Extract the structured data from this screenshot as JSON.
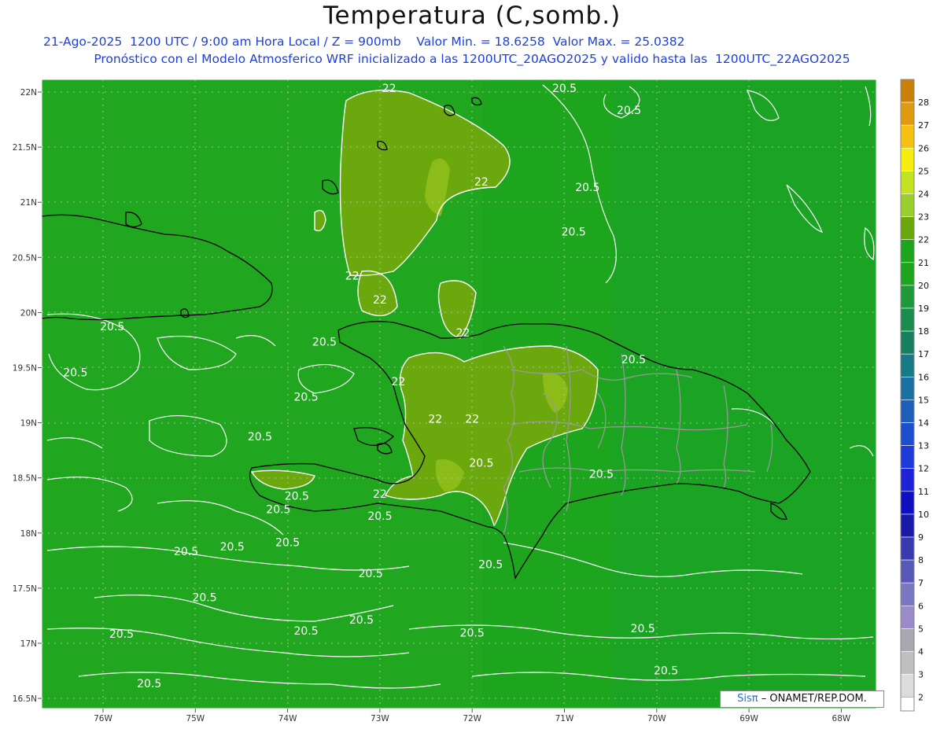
{
  "header": {
    "title": "Temperatura (C,somb.)",
    "subtitle_line1": "21-Ago-2025  1200 UTC / 9:00 am Hora Local / Z = 900mb    Valor Min. = 18.6258  Valor Max. = 25.0382",
    "subtitle_line2": "Pronóstico con el Modelo Atmosferico WRF inicializado a las 1200UTC_20AGO2025 y valido hasta las  1200UTC_22AGO2025"
  },
  "colors": {
    "title": "#111111",
    "subtitle": "#1f3fd9",
    "base_field": "#1ea51e",
    "warm_field": "#6aa80e",
    "warm_core": "#8cbc18",
    "contour": "#ffffff",
    "coast": "#000000",
    "provinces": "#9a9a9a"
  },
  "map": {
    "lat_labels": [
      "22N",
      "21.5N",
      "21N",
      "20.5N",
      "20N",
      "19.5N",
      "19N",
      "18.5N",
      "18N",
      "17.5N",
      "17N",
      "16.5N"
    ],
    "lon_labels": [
      "76W",
      "75W",
      "74W",
      "73W",
      "72W",
      "71W",
      "70W",
      "69W",
      "68W"
    ],
    "contour_labels": [
      {
        "text": "22",
        "lon": -72.9,
        "lat": 22.0
      },
      {
        "text": "22",
        "lon": -71.9,
        "lat": 21.15
      },
      {
        "text": "22",
        "lon": -73.3,
        "lat": 20.3
      },
      {
        "text": "22",
        "lon": -73.0,
        "lat": 20.08
      },
      {
        "text": "22",
        "lon": -72.1,
        "lat": 19.78
      },
      {
        "text": "22",
        "lon": -72.8,
        "lat": 19.34
      },
      {
        "text": "22",
        "lon": -72.4,
        "lat": 19.0
      },
      {
        "text": "22",
        "lon": -72.0,
        "lat": 19.0
      },
      {
        "text": "22",
        "lon": -73.0,
        "lat": 18.32
      },
      {
        "text": "20.5",
        "lon": -71.0,
        "lat": 22.0
      },
      {
        "text": "20.5",
        "lon": -70.3,
        "lat": 21.8
      },
      {
        "text": "20.5",
        "lon": -70.75,
        "lat": 21.1
      },
      {
        "text": "20.5",
        "lon": -70.9,
        "lat": 20.7
      },
      {
        "text": "20.5",
        "lon": -75.9,
        "lat": 19.84
      },
      {
        "text": "20.5",
        "lon": -73.6,
        "lat": 19.7
      },
      {
        "text": "20.5",
        "lon": -76.3,
        "lat": 19.42
      },
      {
        "text": "20.5",
        "lon": -73.8,
        "lat": 19.2
      },
      {
        "text": "20.5",
        "lon": -74.3,
        "lat": 18.84
      },
      {
        "text": "20.5",
        "lon": -71.9,
        "lat": 18.6
      },
      {
        "text": "20.5",
        "lon": -70.6,
        "lat": 18.5
      },
      {
        "text": "20.5",
        "lon": -70.25,
        "lat": 19.54
      },
      {
        "text": "20.5",
        "lon": -73.9,
        "lat": 18.3
      },
      {
        "text": "20.5",
        "lon": -74.1,
        "lat": 18.18
      },
      {
        "text": "20.5",
        "lon": -73.0,
        "lat": 18.12
      },
      {
        "text": "20.5",
        "lon": -74.6,
        "lat": 17.84
      },
      {
        "text": "20.5",
        "lon": -75.1,
        "lat": 17.8
      },
      {
        "text": "20.5",
        "lon": -74.0,
        "lat": 17.88
      },
      {
        "text": "20.5",
        "lon": -71.8,
        "lat": 17.68
      },
      {
        "text": "20.5",
        "lon": -73.1,
        "lat": 17.6
      },
      {
        "text": "20.5",
        "lon": -74.9,
        "lat": 17.38
      },
      {
        "text": "20.5",
        "lon": -73.2,
        "lat": 17.18
      },
      {
        "text": "20.5",
        "lon": -73.8,
        "lat": 17.08
      },
      {
        "text": "20.5",
        "lon": -75.8,
        "lat": 17.05
      },
      {
        "text": "20.5",
        "lon": -72.0,
        "lat": 17.06
      },
      {
        "text": "20.5",
        "lon": -70.15,
        "lat": 17.1
      },
      {
        "text": "20.5",
        "lon": -69.9,
        "lat": 16.72
      },
      {
        "text": "20.5",
        "lon": -75.5,
        "lat": 16.6
      },
      {
        "text": "20.5",
        "lon": -73.1,
        "lat": 16.45
      }
    ]
  },
  "colorbar": {
    "labels": [
      "28",
      "27",
      "26",
      "25",
      "24",
      "23",
      "22",
      "21",
      "20",
      "19",
      "18",
      "17",
      "16",
      "15",
      "14",
      "13",
      "12",
      "11",
      "10",
      "9",
      "8",
      "7",
      "6",
      "5",
      "4",
      "3",
      "2"
    ],
    "colors": [
      "#c8800a",
      "#e09a10",
      "#f5c010",
      "#f5ec10",
      "#c2e420",
      "#9acd2e",
      "#6aa80e",
      "#1ea51e",
      "#1ea51e",
      "#1e9a3c",
      "#1a8c4e",
      "#168060",
      "#187a84",
      "#1a70a0",
      "#1e60b8",
      "#1e4ed0",
      "#1e3ad8",
      "#1e22d8",
      "#1010c0",
      "#1a1aa8",
      "#3a3ab0",
      "#5858b8",
      "#7878c0",
      "#9a8ac8",
      "#a8a8b0",
      "#c0c0c0",
      "#dcdcdc"
    ]
  },
  "credit": {
    "sis": "Sisπ",
    "text": "– ONAMET/REP.DOM."
  }
}
